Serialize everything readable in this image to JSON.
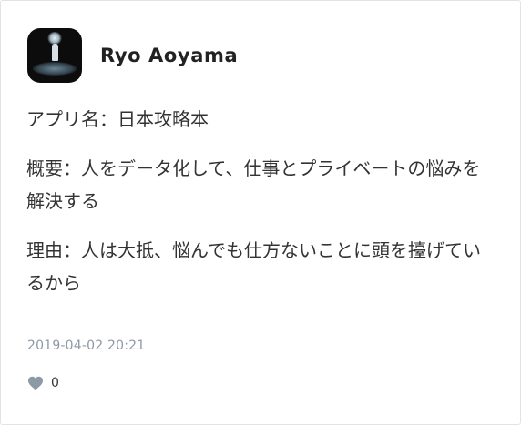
{
  "post": {
    "author": {
      "name": "Ryo Aoyama",
      "avatar_icon": "avatar-photo"
    },
    "paragraphs": [
      "アプリ名：日本攻略本",
      "概要：人をデータ化して、仕事とプライベートの悩みを解決する",
      "理由：人は大抵、悩んでも仕方ないことに頭を擡げているから"
    ],
    "timestamp": "2019-04-02 20:21",
    "likes": {
      "icon": "heart-icon",
      "count": "0",
      "color": "#8d9aa6"
    }
  }
}
